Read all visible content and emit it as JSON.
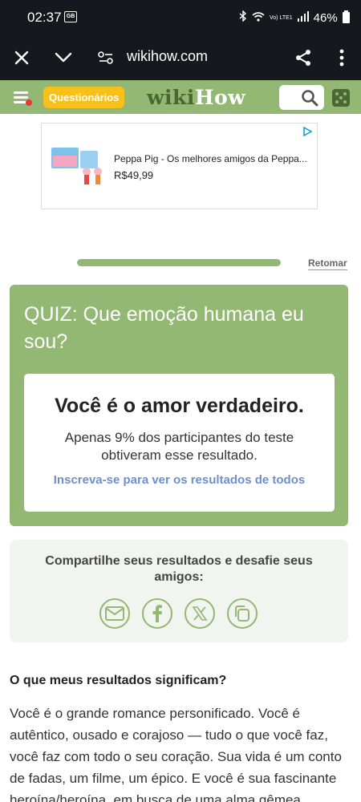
{
  "status_bar": {
    "time": "02:37",
    "notification": "GB",
    "network": "Vo) LTE1",
    "battery": "46%"
  },
  "browser": {
    "url": "wikihow.com"
  },
  "site_header": {
    "quiz_button": "Questionários",
    "logo_wiki": "wiki",
    "logo_how": "How"
  },
  "ad": {
    "title": "Peppa Pig - Os melhores amigos da Peppa...",
    "price": "R$49,99"
  },
  "progress": {
    "fraction": 1.0,
    "resume_link": "Retomar"
  },
  "quiz": {
    "title": "QUIZ: Que emoção humana eu sou?",
    "result_title": "Você é o amor verdadeiro.",
    "result_description": "Apenas 9% dos participantes do teste obtiveram esse resultado.",
    "result_link": "Inscreva-se para ver os resultados de todos"
  },
  "share": {
    "title": "Compartilhe seus resultados e desafie seus amigos:",
    "icons": [
      "email-icon",
      "facebook-icon",
      "x-icon",
      "copy-icon"
    ]
  },
  "article": {
    "heading": "O que meus resultados significam?",
    "body": "Você é o grande romance personificado. Você é autêntico, ousado e corajoso — tudo o que você faz, você faz com todo o seu coração. Sua vida é um conto de fadas, um filme, um épico. E você é sua fascinante heroína/heroína, em busca de uma alma gêmea"
  },
  "colors": {
    "brand_green": "#93b874",
    "dark_green": "#4a6932",
    "quiz_yellow": "#f7c01a",
    "link_blue": "#6e8fc8",
    "status_bg": "#16181d"
  }
}
